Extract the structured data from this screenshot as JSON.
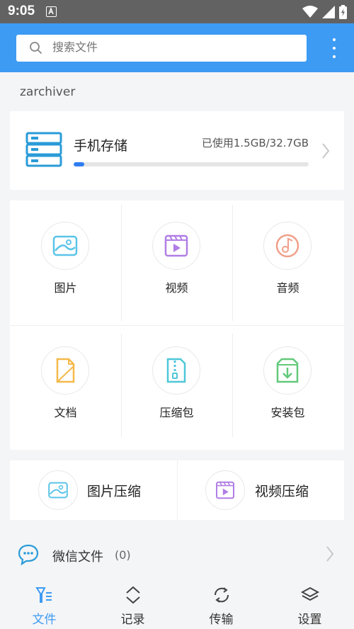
{
  "status_bar": {
    "time": "9:05",
    "notification_icon": "a-icon"
  },
  "search": {
    "placeholder": "搜索文件"
  },
  "username": "zarchiver",
  "storage": {
    "title": "手机存储",
    "usage": "已使用1.5GB/32.7GB",
    "used_fraction": 0.046
  },
  "categories": [
    {
      "label": "图片",
      "icon": "image-icon"
    },
    {
      "label": "视频",
      "icon": "video-icon"
    },
    {
      "label": "音频",
      "icon": "music-icon"
    },
    {
      "label": "文档",
      "icon": "document-icon"
    },
    {
      "label": "压缩包",
      "icon": "archive-icon"
    },
    {
      "label": "安装包",
      "icon": "install-package-icon"
    }
  ],
  "compress": [
    {
      "label": "图片压缩",
      "icon": "image-icon"
    },
    {
      "label": "视频压缩",
      "icon": "video-icon"
    }
  ],
  "wechat": {
    "label": "微信文件",
    "count": "(0)"
  },
  "nav": [
    {
      "label": "文件",
      "icon": "files-icon",
      "active": true
    },
    {
      "label": "记录",
      "icon": "history-icon",
      "active": false
    },
    {
      "label": "传输",
      "icon": "transfer-icon",
      "active": false
    },
    {
      "label": "设置",
      "icon": "settings-icon",
      "active": false
    }
  ],
  "colors": {
    "accent": "#3d9bf3",
    "progress": "#2f7df0",
    "status_bar": "#626262"
  }
}
